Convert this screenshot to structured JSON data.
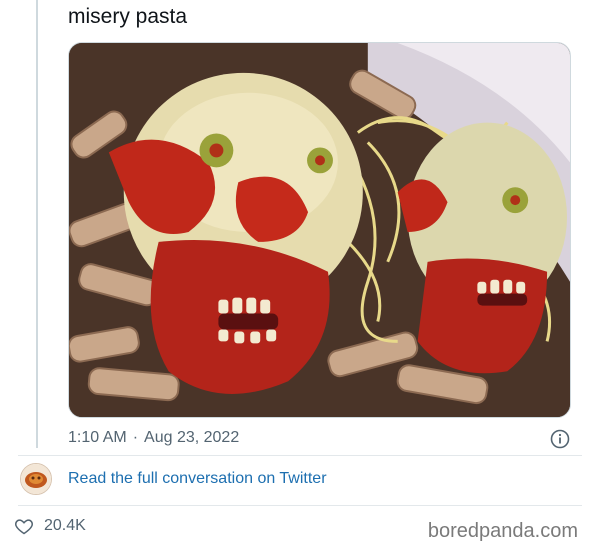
{
  "tweet": {
    "text": "misery pasta",
    "time": "1:10 AM",
    "separator": "·",
    "date": "Aug 23, 2022"
  },
  "media": {
    "icon": "pasta-photo"
  },
  "footer": {
    "read_link": "Read the full conversation on Twitter",
    "likes": "20.4K",
    "source": "boredpanda.com"
  },
  "icons": {
    "info": "info-icon",
    "heart": "heart-icon",
    "avatar": "avatar"
  },
  "colors": {
    "link": "#1d6fb0",
    "muted": "#536471",
    "thread_line": "#cfd9de"
  }
}
